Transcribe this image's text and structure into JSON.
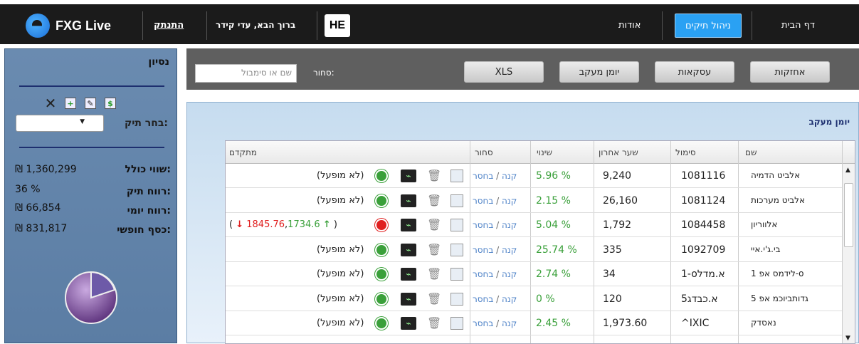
{
  "header": {
    "brand": "FXG Live",
    "logout": "התנתק",
    "welcome": "ברוך הבא, עדי קידר",
    "lang": "HE",
    "nav": {
      "about": "אודות",
      "manage": "ניהול תיקים",
      "home": "דף הבית"
    }
  },
  "sidebar": {
    "title": "נסיון",
    "select_label": "בחר תיק:",
    "select_value": "",
    "stats": [
      {
        "label": "שווי כולל:",
        "value": "₪ 1,360,299"
      },
      {
        "label": "רווח תיק:",
        "value": "36 %"
      },
      {
        "label": "רווח יומי:",
        "value": "₪ 66,854"
      },
      {
        "label": "כסף חופשי:",
        "value": "₪ 831,817"
      }
    ]
  },
  "toolbar": {
    "holdings": "אחזקות",
    "deals": "עסקאות",
    "journal": "יומן מעקב",
    "xls": "XLS",
    "trade_label": "סחור:",
    "search_placeholder": "שם או סימבול"
  },
  "panel": {
    "heading": "יומן מעקב",
    "columns": {
      "name": "שם",
      "symbol": "סימול",
      "last": "שער אחרון",
      "change": "שינוי",
      "trade": "סחור",
      "advanced": "מתקדם"
    },
    "trade_buy": "קנה",
    "trade_sep": "/",
    "trade_sell": "בחסר",
    "rows": [
      {
        "name": "אלביט הדמיה",
        "symbol": "1081116",
        "last": "9,240",
        "change": "5.96 %",
        "status": "green",
        "advanced": "(לא מופעל)"
      },
      {
        "name": "אלביט מערכות",
        "symbol": "1081124",
        "last": "26,160",
        "change": "2.15 %",
        "status": "green",
        "advanced": "(לא מופעל)"
      },
      {
        "name": "אלווריון",
        "symbol": "1084458",
        "last": "1,792",
        "change": "5.04 %",
        "status": "red",
        "advanced": "",
        "adv_up": "1734.6",
        "adv_down": "1845.76"
      },
      {
        "name": "בי.ג'י.איי",
        "symbol": "1092709",
        "last": "335",
        "change": "25.74 %",
        "status": "green",
        "advanced": "(לא מופעל)"
      },
      {
        "name": "לידמס אפ 1-o",
        "symbol": "1-oא.מדל",
        "last": "34",
        "change": "2.74 %",
        "status": "green",
        "advanced": "(לא מופעל)"
      },
      {
        "name": "גדותביוכמ אפ 5",
        "symbol": "5א.כבדג",
        "last": "120",
        "change": "0 %",
        "status": "green",
        "advanced": "(לא מופעל)"
      },
      {
        "name": "נאסדק",
        "symbol": "^IXIC",
        "last": "1,973.60",
        "change": "2.45 %",
        "status": "green",
        "advanced": "(לא מופעל)"
      }
    ]
  },
  "colors": {
    "accent": "#2aa1f3",
    "topbar": "#1b1b1b",
    "sidebar": "#6a8bb0",
    "up": "#3aa03a",
    "down": "#e02020"
  }
}
